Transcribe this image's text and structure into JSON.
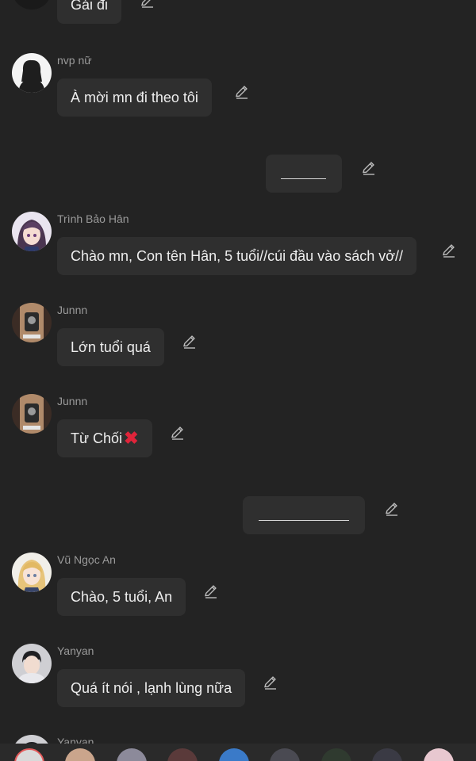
{
  "messages": [
    {
      "name": "",
      "text": "Gái đi"
    },
    {
      "name": "nvp nữ",
      "text": "À mời mn đi theo tôi"
    },
    {
      "name": "Trình Bảo Hân",
      "text": "Chào mn, Con tên Hân, 5 tuổi//cúi đầu vào sách vở//"
    },
    {
      "name": "Junnn",
      "text": "Lớn tuổi quá"
    },
    {
      "name": "Junnn",
      "text": "Từ Chối"
    },
    {
      "name": "Vũ Ngọc An",
      "text": "Chào, 5 tuổi, An"
    },
    {
      "name": "Yanyan",
      "text": "Quá ít nói , lạnh lùng nữa"
    },
    {
      "name": "Yanyan",
      "text": ""
    }
  ],
  "icons": {
    "edit": "pencil-edit-icon",
    "reject": "cross-mark-emoji"
  },
  "colors": {
    "background": "#232323",
    "bubble": "#2f2f2f",
    "name_text": "#9a9a9a",
    "reject_mark": "#e0243a"
  },
  "reject_mark_glyph": "✖"
}
